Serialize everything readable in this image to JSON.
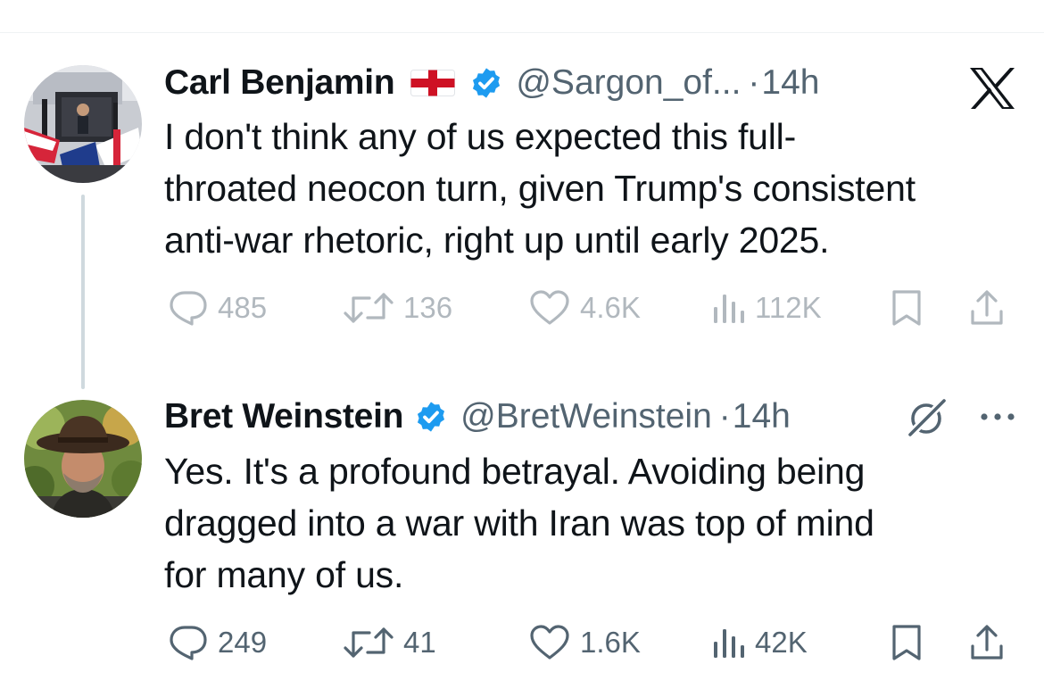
{
  "tweets": [
    {
      "author_name": "Carl Benjamin",
      "flag": "england-flag-icon",
      "verified": true,
      "handle": "@Sargon_of...",
      "separator": "·",
      "time": "14h",
      "text_lines": [
        "I don't think any of us expected this full-",
        "throated neocon turn, given Trump's consistent",
        "anti-war rhetoric, right up until early 2025."
      ],
      "stats": {
        "replies": "485",
        "retweets": "136",
        "likes": "4.6K",
        "views": "112K"
      }
    },
    {
      "author_name": "Bret Weinstein",
      "verified": true,
      "handle": "@BretWeinstein",
      "separator": "·",
      "time": "14h",
      "text_lines": [
        "Yes. It's a profound betrayal. Avoiding being",
        "dragged into a war with Iran was top of mind",
        "for many of us."
      ],
      "stats": {
        "replies": "249",
        "retweets": "41",
        "likes": "1.6K",
        "views": "42K"
      }
    }
  ],
  "icons": {
    "logo": "x-logo-icon",
    "grok": "grok-icon",
    "more": "more-icon",
    "reply": "reply-icon",
    "retweet": "retweet-icon",
    "like": "heart-icon",
    "views": "analytics-icon",
    "bookmark": "bookmark-icon",
    "share": "share-icon"
  },
  "colors": {
    "text": "#0f1419",
    "secondary": "#536471",
    "verified": "#1d9bf0",
    "thread_line": "#cfd9de"
  }
}
